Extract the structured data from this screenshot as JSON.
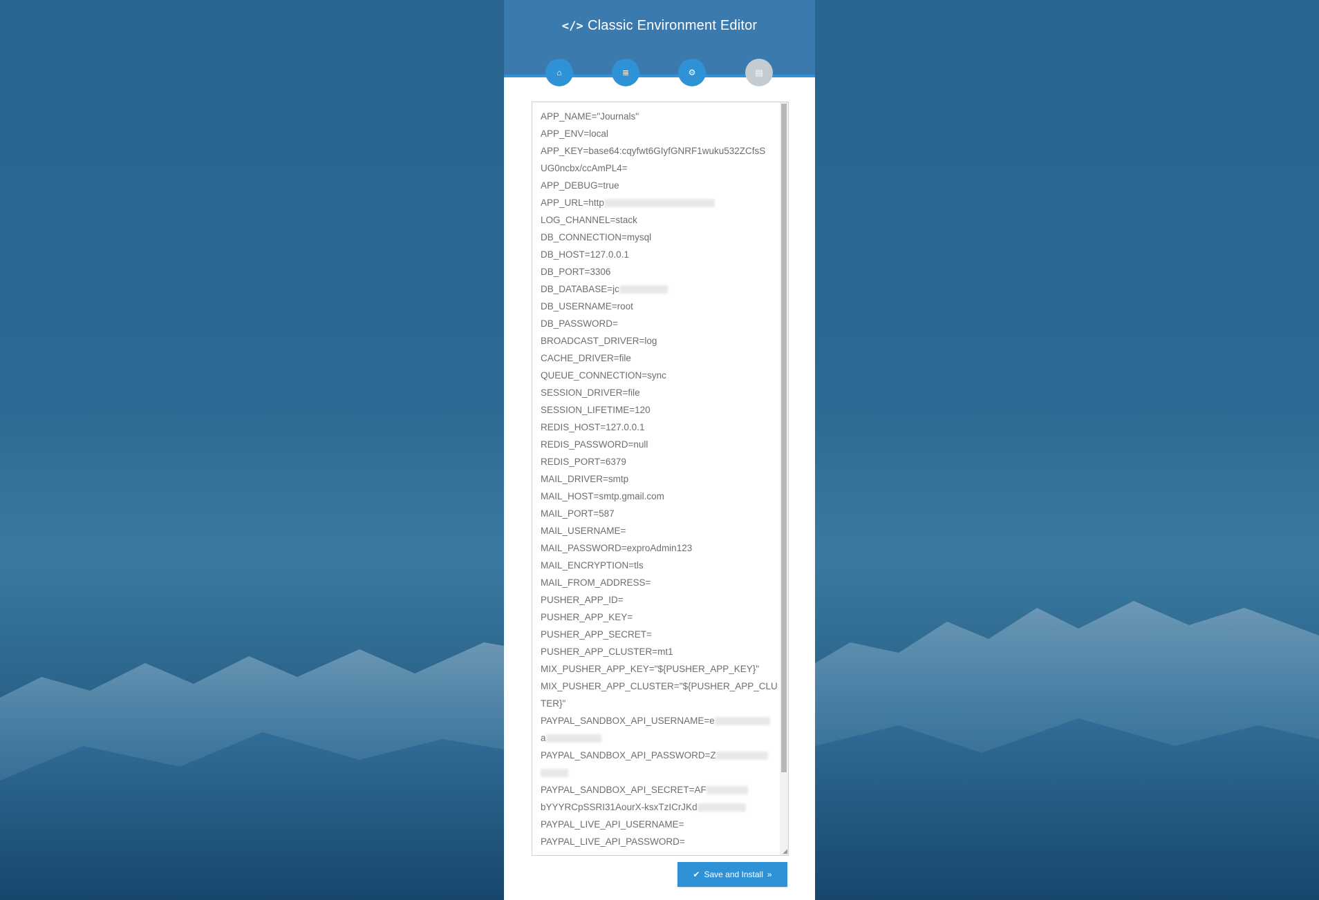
{
  "page": {
    "title": "Classic Environment Editor",
    "title_icon": "</>",
    "colors": {
      "header": "#3a7aaf",
      "accent": "#2f92d6",
      "step_disabled": "#c4cbd1",
      "background": "#2a6490"
    }
  },
  "steps": [
    {
      "icon": "home-icon",
      "glyph": "⌂",
      "state": "done"
    },
    {
      "icon": "list-icon",
      "glyph": "≣",
      "state": "done"
    },
    {
      "icon": "gear-icon",
      "glyph": "⚙",
      "state": "active"
    },
    {
      "icon": "server-icon",
      "glyph": "▤",
      "state": "disabled"
    }
  ],
  "editor": {
    "lines": [
      "APP_NAME=\"Journals\"",
      "APP_ENV=local",
      "APP_KEY=base64:cqyfwt6GIyfGNRF1wuku532ZCfsS",
      "UG0ncbx/ccAmPL4=",
      "APP_DEBUG=true",
      "APP_URL=http",
      "LOG_CHANNEL=stack",
      "DB_CONNECTION=mysql",
      "DB_HOST=127.0.0.1",
      "DB_PORT=3306",
      "DB_DATABASE=jc",
      "DB_USERNAME=root",
      "DB_PASSWORD=",
      "BROADCAST_DRIVER=log",
      "CACHE_DRIVER=file",
      "QUEUE_CONNECTION=sync",
      "SESSION_DRIVER=file",
      "SESSION_LIFETIME=120",
      "REDIS_HOST=127.0.0.1",
      "REDIS_PASSWORD=null",
      "REDIS_PORT=6379",
      "MAIL_DRIVER=smtp",
      "MAIL_HOST=smtp.gmail.com",
      "MAIL_PORT=587",
      "MAIL_USERNAME=",
      "MAIL_PASSWORD=exproAdmin123",
      "MAIL_ENCRYPTION=tls",
      "MAIL_FROM_ADDRESS=",
      "PUSHER_APP_ID=",
      "PUSHER_APP_KEY=",
      "PUSHER_APP_SECRET=",
      "PUSHER_APP_CLUSTER=mt1",
      "MIX_PUSHER_APP_KEY=\"${PUSHER_APP_KEY}\"",
      "MIX_PUSHER_APP_CLUSTER=\"${PUSHER_APP_CLUS",
      "TER}\"",
      "PAYPAL_SANDBOX_API_USERNAME=e",
      "a",
      "PAYPAL_SANDBOX_API_PASSWORD=Z",
      "",
      "PAYPAL_SANDBOX_API_SECRET=AF",
      "bYYYRCpSSRI31AourX-ksxTzICrJKd",
      "PAYPAL_LIVE_API_USERNAME=",
      "PAYPAL_LIVE_API_PASSWORD="
    ]
  },
  "actions": {
    "save_label": "Save and Install",
    "save_icon": "check-icon",
    "save_trailing_icon": "double-chevron-right-icon"
  }
}
